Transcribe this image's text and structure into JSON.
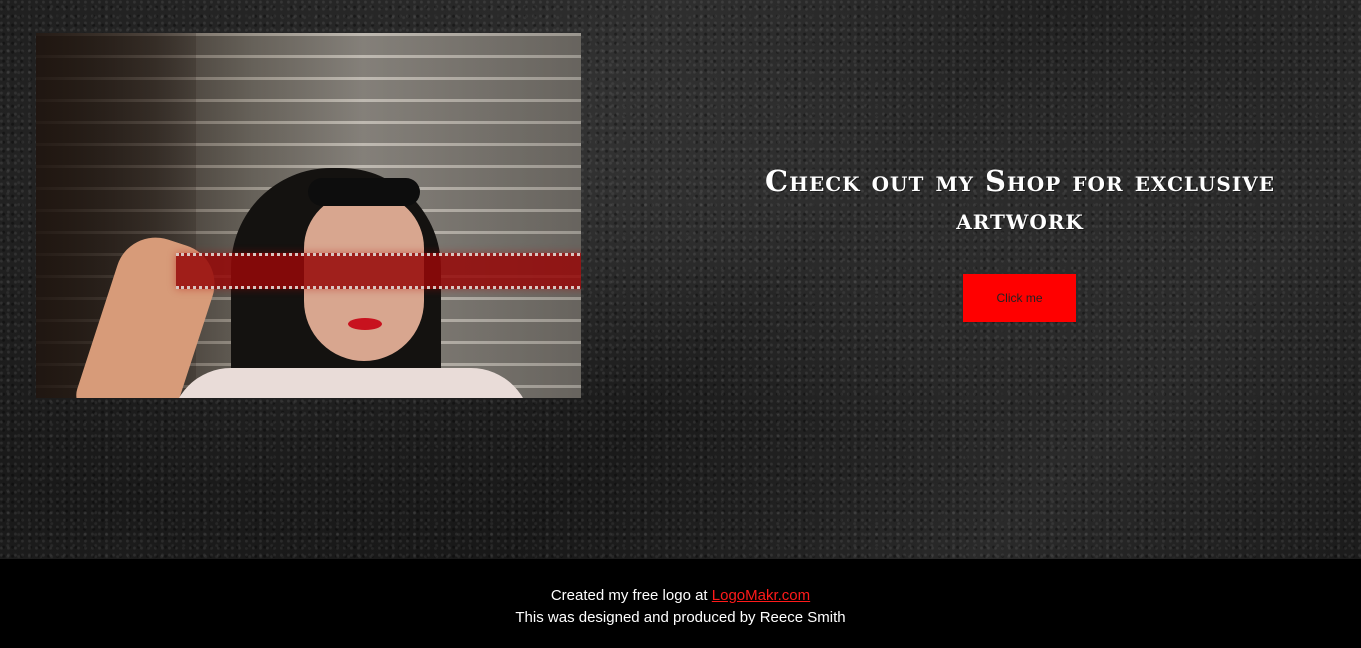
{
  "hero": {
    "heading": "Check out my Shop for exclusive artwork",
    "button_label": "Click me",
    "button_color": "#ff0000",
    "photo_alt": "Portrait photo"
  },
  "footer": {
    "line1_prefix": "Created my free logo at ",
    "link_text": "LogoMakr.com",
    "line2": "This was designed and produced by Reece Smith",
    "link_color": "#ff1a1a"
  }
}
